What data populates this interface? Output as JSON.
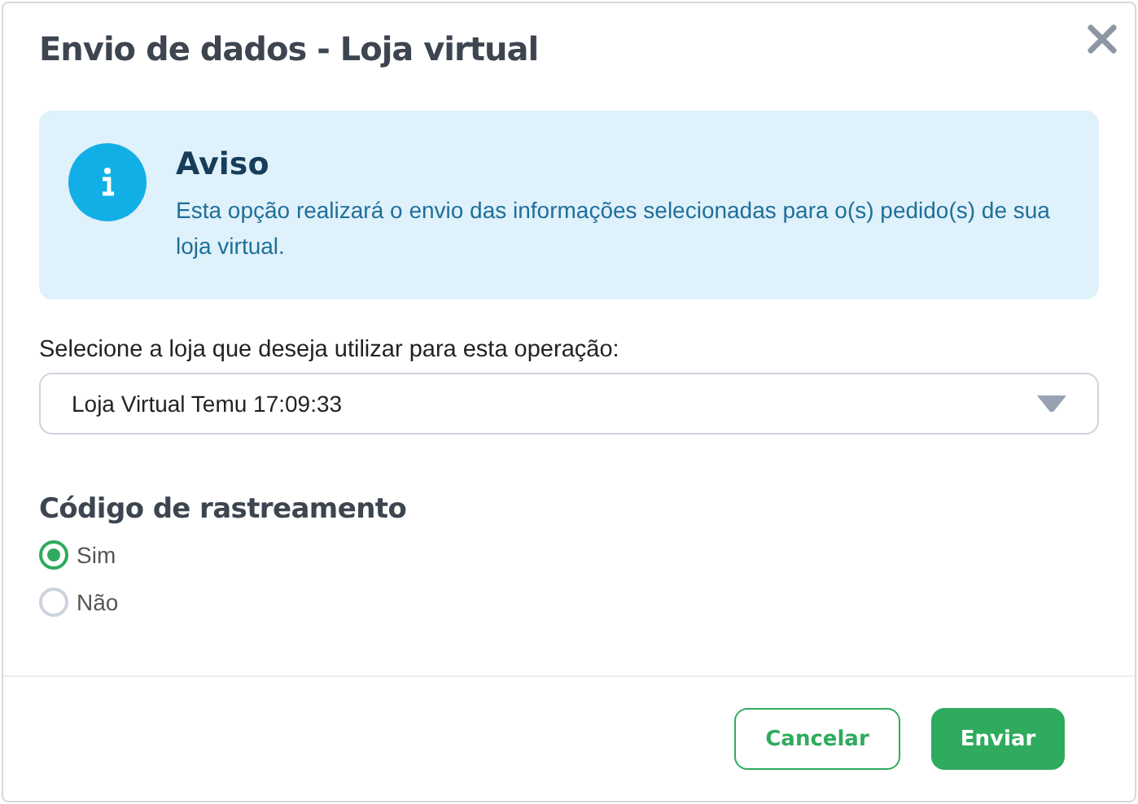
{
  "dialog": {
    "title": "Envio de dados - Loja virtual"
  },
  "notice": {
    "title": "Aviso",
    "text": "Esta opção realizará o envio das informações selecionadas para o(s) pedido(s) de sua loja virtual."
  },
  "store_select": {
    "label": "Selecione a loja que deseja utilizar para esta operação:",
    "value": "Loja Virtual Temu 17:09:33"
  },
  "tracking": {
    "title": "Código de rastreamento",
    "options": [
      {
        "label": "Sim",
        "selected": true
      },
      {
        "label": "Não",
        "selected": false
      }
    ]
  },
  "buttons": [
    {
      "label": "Cancelar",
      "kind": "secondary"
    },
    {
      "label": "Enviar",
      "kind": "primary"
    }
  ]
}
